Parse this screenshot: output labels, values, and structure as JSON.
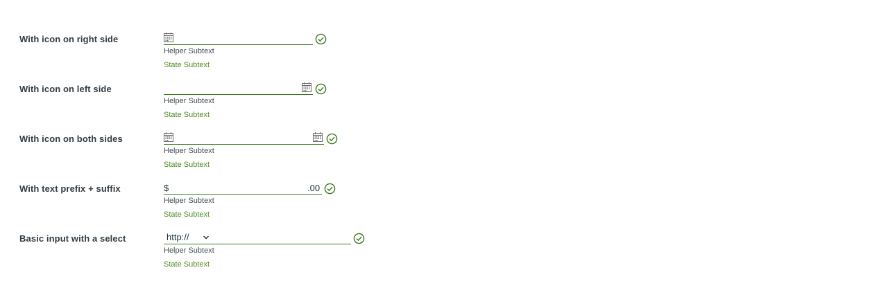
{
  "colors": {
    "success": "#3c7a1e",
    "state_text": "#4f8b23",
    "label_text": "#333c42",
    "helper_text": "#454f55"
  },
  "rows": [
    {
      "label": "With icon on right side",
      "helper": "Helper Subtext",
      "state": "State Subtext",
      "icon": "calendar-icon",
      "status_icon": "success-check-icon"
    },
    {
      "label": "With icon on left side",
      "helper": "Helper Subtext",
      "state": "State Subtext",
      "icon": "calendar-icon",
      "status_icon": "success-check-icon"
    },
    {
      "label": "With icon on both sides",
      "helper": "Helper Subtext",
      "state": "State Subtext",
      "icon": "calendar-icon",
      "status_icon": "success-check-icon"
    },
    {
      "label": "With text prefix + suffix",
      "prefix": "$",
      "suffix": ".00",
      "helper": "Helper Subtext",
      "state": "State Subtext",
      "status_icon": "success-check-icon"
    },
    {
      "label": "Basic input with a select",
      "select_value": "http://",
      "helper": "Helper Subtext",
      "state": "State Subtext",
      "status_icon": "success-check-icon"
    }
  ]
}
